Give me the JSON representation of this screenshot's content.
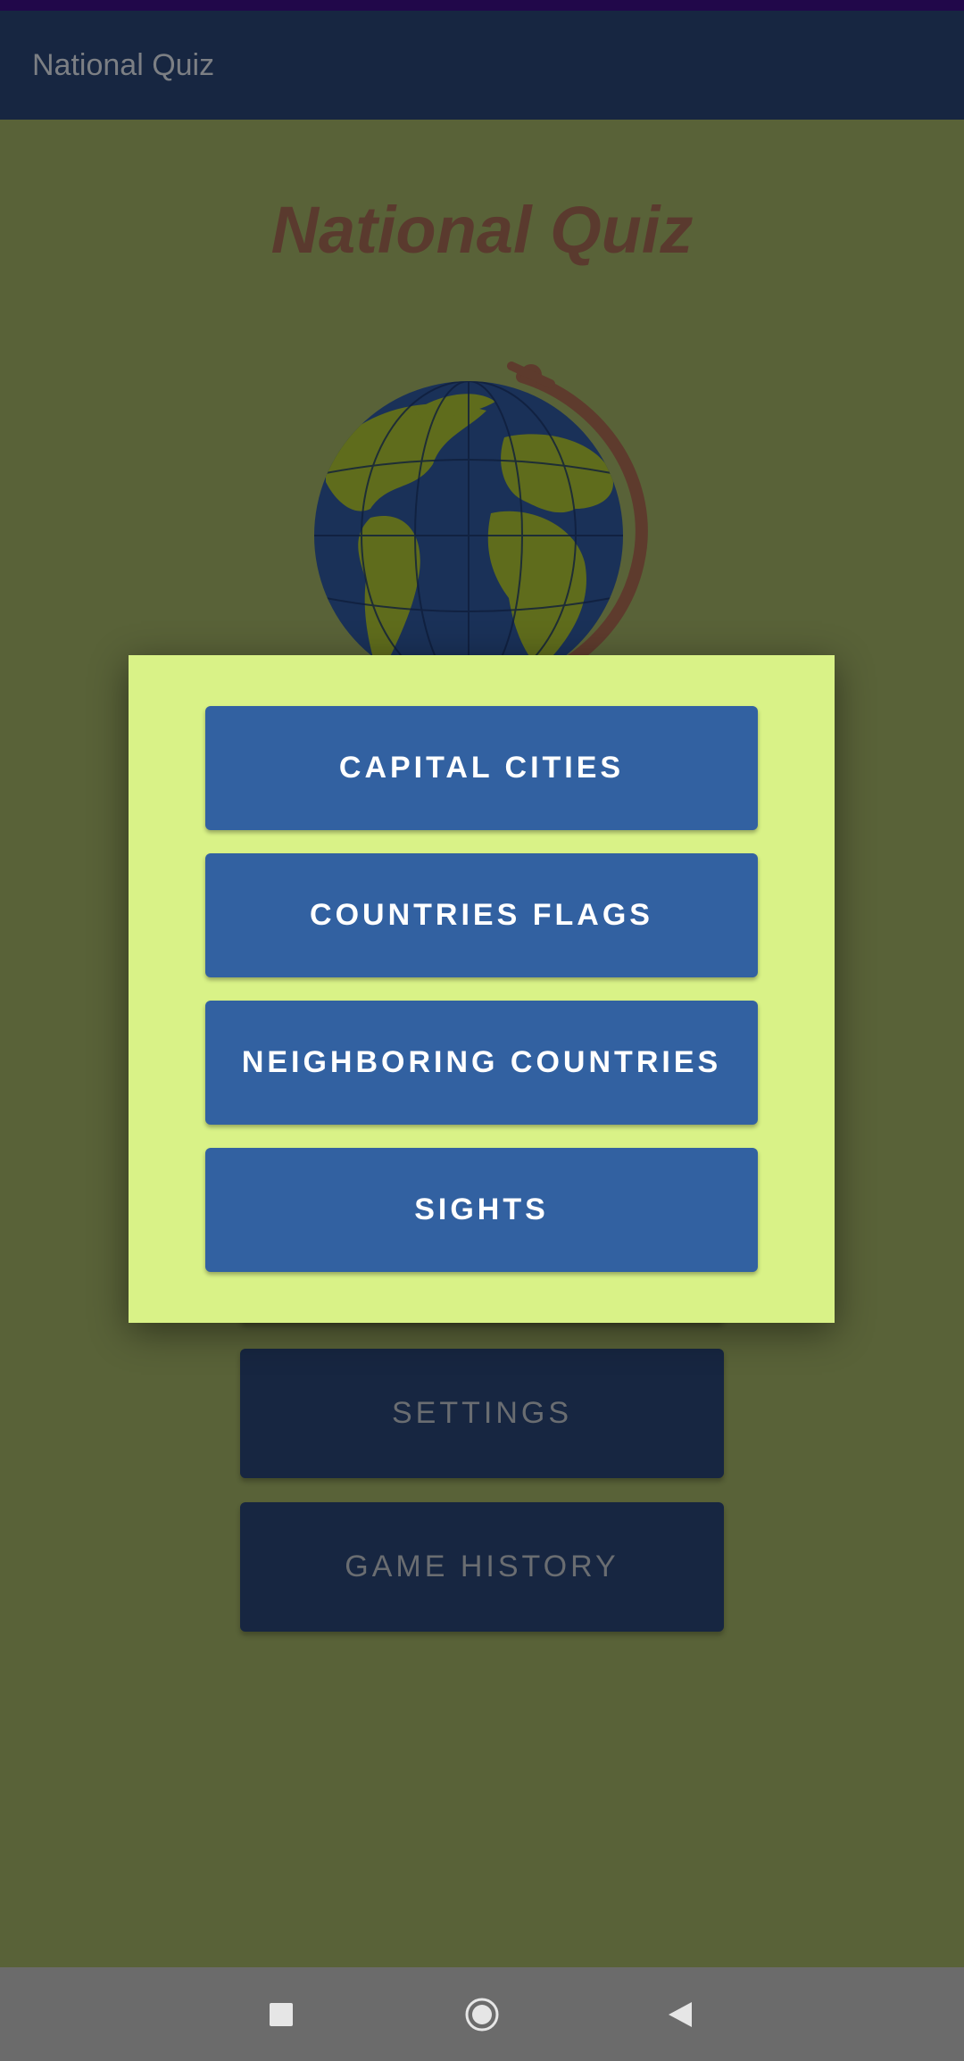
{
  "app_bar": {
    "title": "National Quiz"
  },
  "hero": {
    "title": "National Quiz"
  },
  "background_buttons": {
    "settings": "SETTINGS",
    "game_history": "GAME HISTORY"
  },
  "dialog": {
    "options": [
      {
        "label": "CAPITAL CITIES"
      },
      {
        "label": "COUNTRIES FLAGS"
      },
      {
        "label": "NEIGHBORING COUNTRIES"
      },
      {
        "label": "SIGHTS"
      }
    ]
  },
  "colors": {
    "status_bar": "#21084a",
    "app_bar": "#172641",
    "scrim_background": "#596238",
    "dialog_background": "#d9f287",
    "dialog_button": "#3261a1",
    "hero_title": "#5a3a2e"
  },
  "nav_bar": {
    "icons": [
      "recents-square-icon",
      "home-circle-icon",
      "back-triangle-icon"
    ]
  }
}
